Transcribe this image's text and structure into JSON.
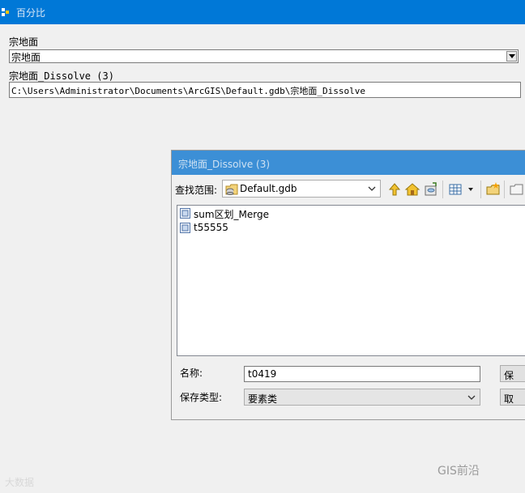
{
  "window": {
    "title": "百分比"
  },
  "form": {
    "input_label": "宗地面",
    "input_value": "宗地面",
    "output_label": "宗地面_Dissolve (3)",
    "output_path": "C:\\Users\\Administrator\\Documents\\ArcGIS\\Default.gdb\\宗地面_Dissolve"
  },
  "dialog": {
    "title": "宗地面_Dissolve (3)",
    "look_in_label": "查找范围:",
    "look_in_value": "Default.gdb",
    "files": [
      {
        "name": "sum区划_Merge"
      },
      {
        "name": "t55555"
      }
    ],
    "name_label": "名称:",
    "name_value": "t0419",
    "type_label": "保存类型:",
    "type_value": "要素类",
    "save_label": "保",
    "cancel_label": "取"
  },
  "watermarks": {
    "left": "大数据",
    "right": "GIS前沿"
  },
  "colors": {
    "titlebar": "#0078d7",
    "dialog_title": "#3c8fd6"
  }
}
